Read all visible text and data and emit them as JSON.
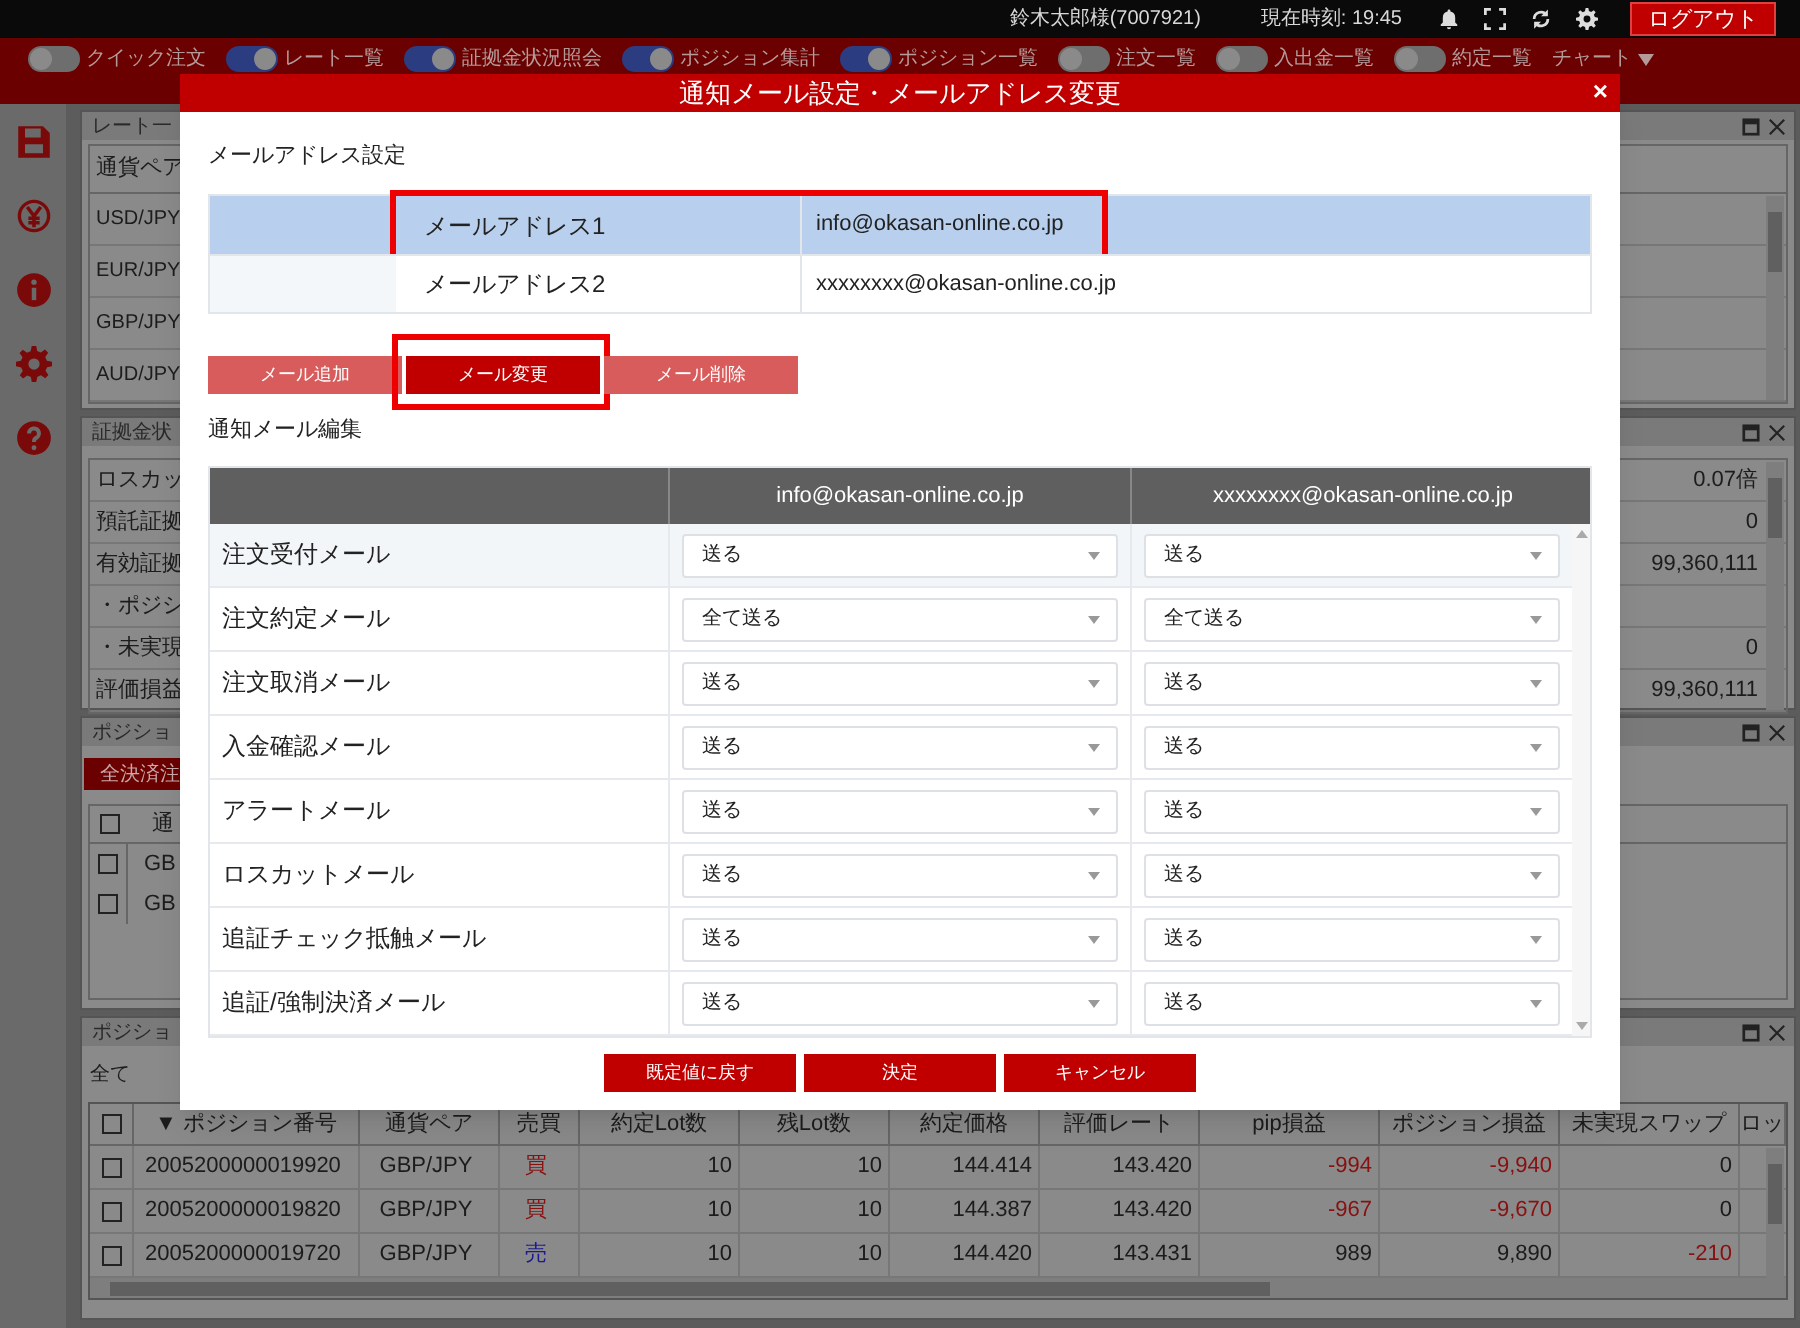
{
  "header": {
    "user": "鈴木太郎様(7007921)",
    "clock": "現在時刻: 19:45",
    "logout": "ログアウト"
  },
  "toolbar": [
    {
      "label": "クイック注文",
      "on": false
    },
    {
      "label": "レート一覧",
      "on": true
    },
    {
      "label": "証拠金状況照会",
      "on": true
    },
    {
      "label": "ポジション集計",
      "on": true
    },
    {
      "label": "ポジション一覧",
      "on": true
    },
    {
      "label": "注文一覧",
      "on": false
    },
    {
      "label": "入出金一覧",
      "on": false
    },
    {
      "label": "約定一覧",
      "on": false
    }
  ],
  "chart_menu": "チャート",
  "rate_panel": {
    "title": "レート一",
    "column": "通貨ペア",
    "rows": [
      "USD/JPY",
      "EUR/JPY",
      "GBP/JPY",
      "AUD/JPY"
    ]
  },
  "margin_panel": {
    "title": "証拠金状",
    "rows": [
      {
        "label": "ロスカッ",
        "value": "0.07倍"
      },
      {
        "label": "預託証拠",
        "value": "0"
      },
      {
        "label": "有効証拠",
        "value": "99,360,111"
      },
      {
        "label": "・ポジシ"
      },
      {
        "label": "・未実現",
        "value": "0"
      },
      {
        "label": "評価損益",
        "value": "99,360,111"
      }
    ]
  },
  "summary_panel": {
    "title": "ポジショ",
    "button": "全決済注",
    "column": "通",
    "all_checked": false,
    "rows": [
      {
        "pair": "GB",
        "checked": false
      },
      {
        "pair": "GB",
        "checked": false
      }
    ]
  },
  "position_panel": {
    "title": "ポジショ",
    "filter": "全て",
    "all_checked": false,
    "columns": [
      "▼ ポジション番号",
      "通貨ペア",
      "売買",
      "約定Lot数",
      "残Lot数",
      "約定価格",
      "評価レート",
      "pip損益",
      "ポジション損益",
      "未実現スワップ",
      "ロッ"
    ],
    "rows": [
      {
        "checked": false,
        "number": "2005200000019920",
        "pair": "GBP/JPY",
        "side": {
          "text": "買",
          "kind": "buy"
        },
        "lots": "10",
        "remaining": "10",
        "price": "144.414",
        "rate": "143.420",
        "pip": {
          "text": "-994",
          "loss": true
        },
        "pl": {
          "text": "-9,940",
          "loss": true
        },
        "swap": {
          "text": "0",
          "loss": false
        }
      },
      {
        "checked": false,
        "number": "2005200000019820",
        "pair": "GBP/JPY",
        "side": {
          "text": "買",
          "kind": "buy"
        },
        "lots": "10",
        "remaining": "10",
        "price": "144.387",
        "rate": "143.420",
        "pip": {
          "text": "-967",
          "loss": true
        },
        "pl": {
          "text": "-9,670",
          "loss": true
        },
        "swap": {
          "text": "0",
          "loss": false
        }
      },
      {
        "checked": false,
        "number": "2005200000019720",
        "pair": "GBP/JPY",
        "side": {
          "text": "売",
          "kind": "sell"
        },
        "lots": "10",
        "remaining": "10",
        "price": "144.420",
        "rate": "143.431",
        "pip": {
          "text": "989",
          "loss": false
        },
        "pl": {
          "text": "9,890",
          "loss": false
        },
        "swap": {
          "text": "-210",
          "loss": true
        }
      }
    ]
  },
  "dialog": {
    "title": "通知メール設定・メールアドレス変更",
    "close": "×",
    "address_heading": "メールアドレス設定",
    "addresses": [
      {
        "label": "メールアドレス1",
        "address": "info@okasan-online.co.jp",
        "selected": true,
        "highlighted": true
      },
      {
        "label": "メールアドレス2",
        "address": "xxxxxxxx@okasan-online.co.jp",
        "selected": false,
        "highlighted": false
      }
    ],
    "address_buttons": [
      {
        "label": "メール追加",
        "selected": false,
        "highlighted": false
      },
      {
        "label": "メール変更",
        "selected": true,
        "highlighted": true
      },
      {
        "label": "メール削除",
        "selected": false,
        "highlighted": false
      }
    ],
    "notify_heading": "通知メール編集",
    "columns": [
      "info@okasan-online.co.jp",
      "xxxxxxxx@okasan-online.co.jp"
    ],
    "rows": [
      {
        "label": "注文受付メール",
        "selected": true,
        "values": [
          "送る",
          "送る"
        ]
      },
      {
        "label": "注文約定メール",
        "selected": false,
        "values": [
          "全て送る",
          "全て送る"
        ]
      },
      {
        "label": "注文取消メール",
        "selected": false,
        "values": [
          "送る",
          "送る"
        ]
      },
      {
        "label": "入金確認メール",
        "selected": false,
        "values": [
          "送る",
          "送る"
        ]
      },
      {
        "label": "アラートメール",
        "selected": false,
        "values": [
          "送る",
          "送る"
        ]
      },
      {
        "label": "ロスカットメール",
        "selected": false,
        "values": [
          "送る",
          "送る"
        ]
      },
      {
        "label": "追証チェック抵触メール",
        "selected": false,
        "values": [
          "送る",
          "送る"
        ]
      },
      {
        "label": "追証/強制決済メール",
        "selected": false,
        "values": [
          "送る",
          "送る"
        ]
      }
    ],
    "footer_buttons": [
      "既定値に戻す",
      "決定",
      "キャンセル"
    ]
  }
}
